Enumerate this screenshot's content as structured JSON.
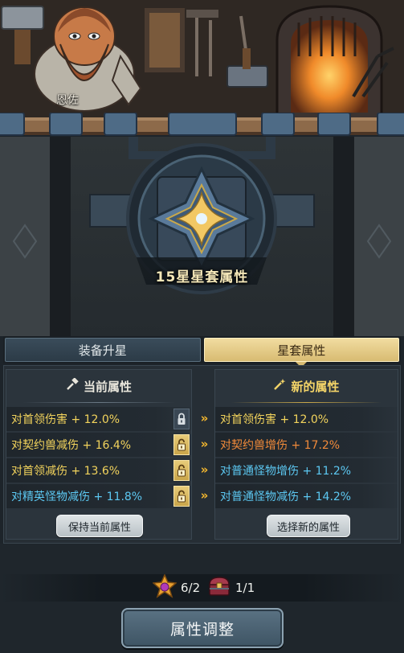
{
  "npc": {
    "name": "恩佐"
  },
  "emblem": {
    "title": "15星星套属性"
  },
  "tabs": [
    {
      "label": "装备升星",
      "active": false
    },
    {
      "label": "星套属性",
      "active": true
    }
  ],
  "current_attributes": {
    "heading": "当前属性",
    "rows": [
      {
        "text": "对首领伤害 + 12.0%",
        "color": "#f2d35c",
        "lock": "closed"
      },
      {
        "text": "对契约兽减伤 + 16.4%",
        "color": "#f2d35c",
        "lock": "open"
      },
      {
        "text": "对首领减伤 + 13.6%",
        "color": "#f2d35c",
        "lock": "open"
      },
      {
        "text": "对精英怪物减伤 + 11.8%",
        "color": "#5cc8f2",
        "lock": "open"
      }
    ],
    "button": "保持当前属性"
  },
  "new_attributes": {
    "heading": "新的属性",
    "rows": [
      {
        "text": "对首领伤害 + 12.0%",
        "color": "#f2d35c"
      },
      {
        "text": "对契约兽增伤 + 17.2%",
        "color": "#f08a3a"
      },
      {
        "text": "对普通怪物增伤 + 11.2%",
        "color": "#5cc8f2"
      },
      {
        "text": "对普通怪物减伤 + 14.2%",
        "color": "#5cc8f2"
      }
    ],
    "button": "选择新的属性"
  },
  "arrow_glyph": "»",
  "costs": [
    {
      "icon": "star-stone-icon",
      "amount": "6/2"
    },
    {
      "icon": "treasure-chest-icon",
      "amount": "1/1"
    }
  ],
  "main_button": "属性调整",
  "colors": {
    "gold": "#f4d568",
    "yellow_text": "#f2d35c",
    "cyan_text": "#5cc8f2",
    "orange_text": "#f08a3a",
    "arrow": "#f5b82e"
  }
}
